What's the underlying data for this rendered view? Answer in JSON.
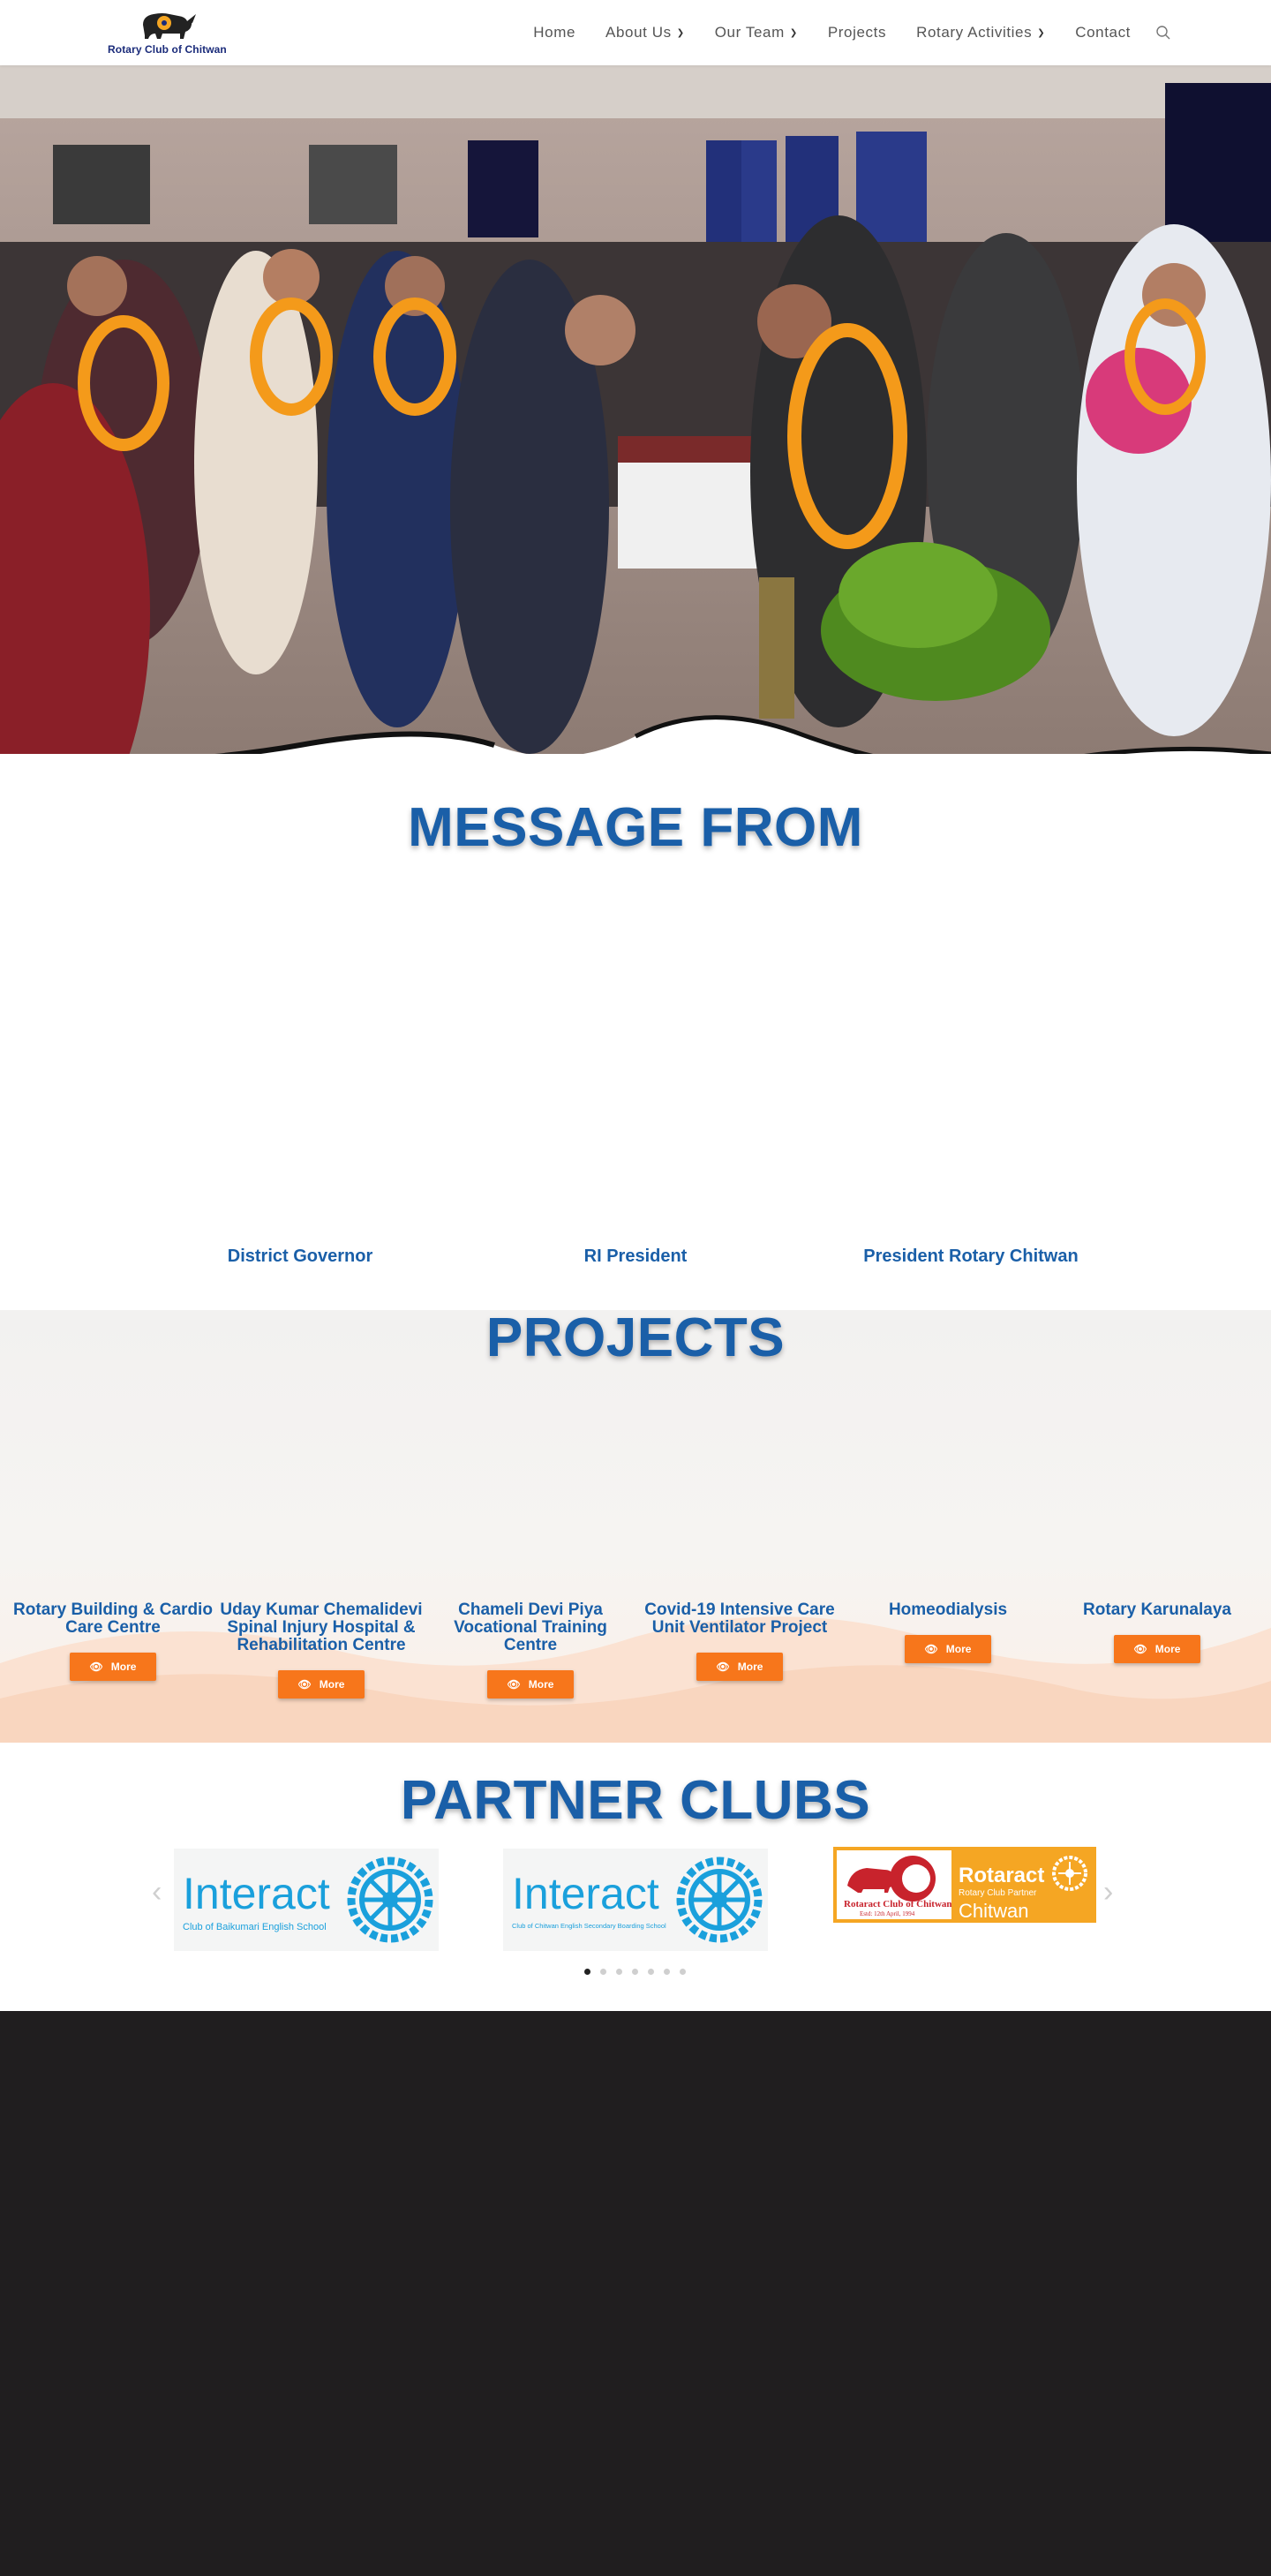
{
  "header": {
    "logo_text": "Rotary Club of Chitwan",
    "nav": [
      {
        "label": "Home",
        "has_dropdown": false
      },
      {
        "label": "About Us",
        "has_dropdown": true
      },
      {
        "label": "Our Team",
        "has_dropdown": true
      },
      {
        "label": "Projects",
        "has_dropdown": false
      },
      {
        "label": "Rotary Activities",
        "has_dropdown": true
      },
      {
        "label": "Contact",
        "has_dropdown": false
      }
    ],
    "search_icon": "search-icon"
  },
  "message": {
    "title": "MESSAGE FROM",
    "roles": [
      "District Governor",
      "RI President",
      "President Rotary Chitwan"
    ]
  },
  "projects": {
    "title": "PROJECTS",
    "button_label": "More",
    "items": [
      {
        "name": "Rotary Building & Cardio Care Centre"
      },
      {
        "name": "Uday Kumar Chemalidevi Spinal Injury Hospital & Rehabilitation Centre"
      },
      {
        "name": "Chameli Devi Piya Vocational Training Centre"
      },
      {
        "name": "Covid-19 Intensive Care Unit Ventilator Project"
      },
      {
        "name": "Homeodialysis"
      },
      {
        "name": "Rotary Karunalaya"
      }
    ]
  },
  "partners": {
    "title": "PARTNER CLUBS",
    "logos": [
      {
        "word": "Interact",
        "sub": "Club of Baikumari English School"
      },
      {
        "word": "Interact",
        "sub": "Club of Chitwan English Secondary Boarding School"
      },
      {
        "club": "Rotaract Club of Chitwan",
        "est": "Estd: 12th April, 1994",
        "word": "Rotaract",
        "sub": "Rotary Club Partner",
        "city": "Chitwan"
      }
    ],
    "slides": 7,
    "active_slide": 0
  },
  "colors": {
    "brand_blue": "#1a5fa8",
    "accent_orange": "#f7761b",
    "footer_bg": "#201e1f",
    "interact_blue": "#1aa0dc",
    "rotaract_gold": "#f5a623"
  }
}
